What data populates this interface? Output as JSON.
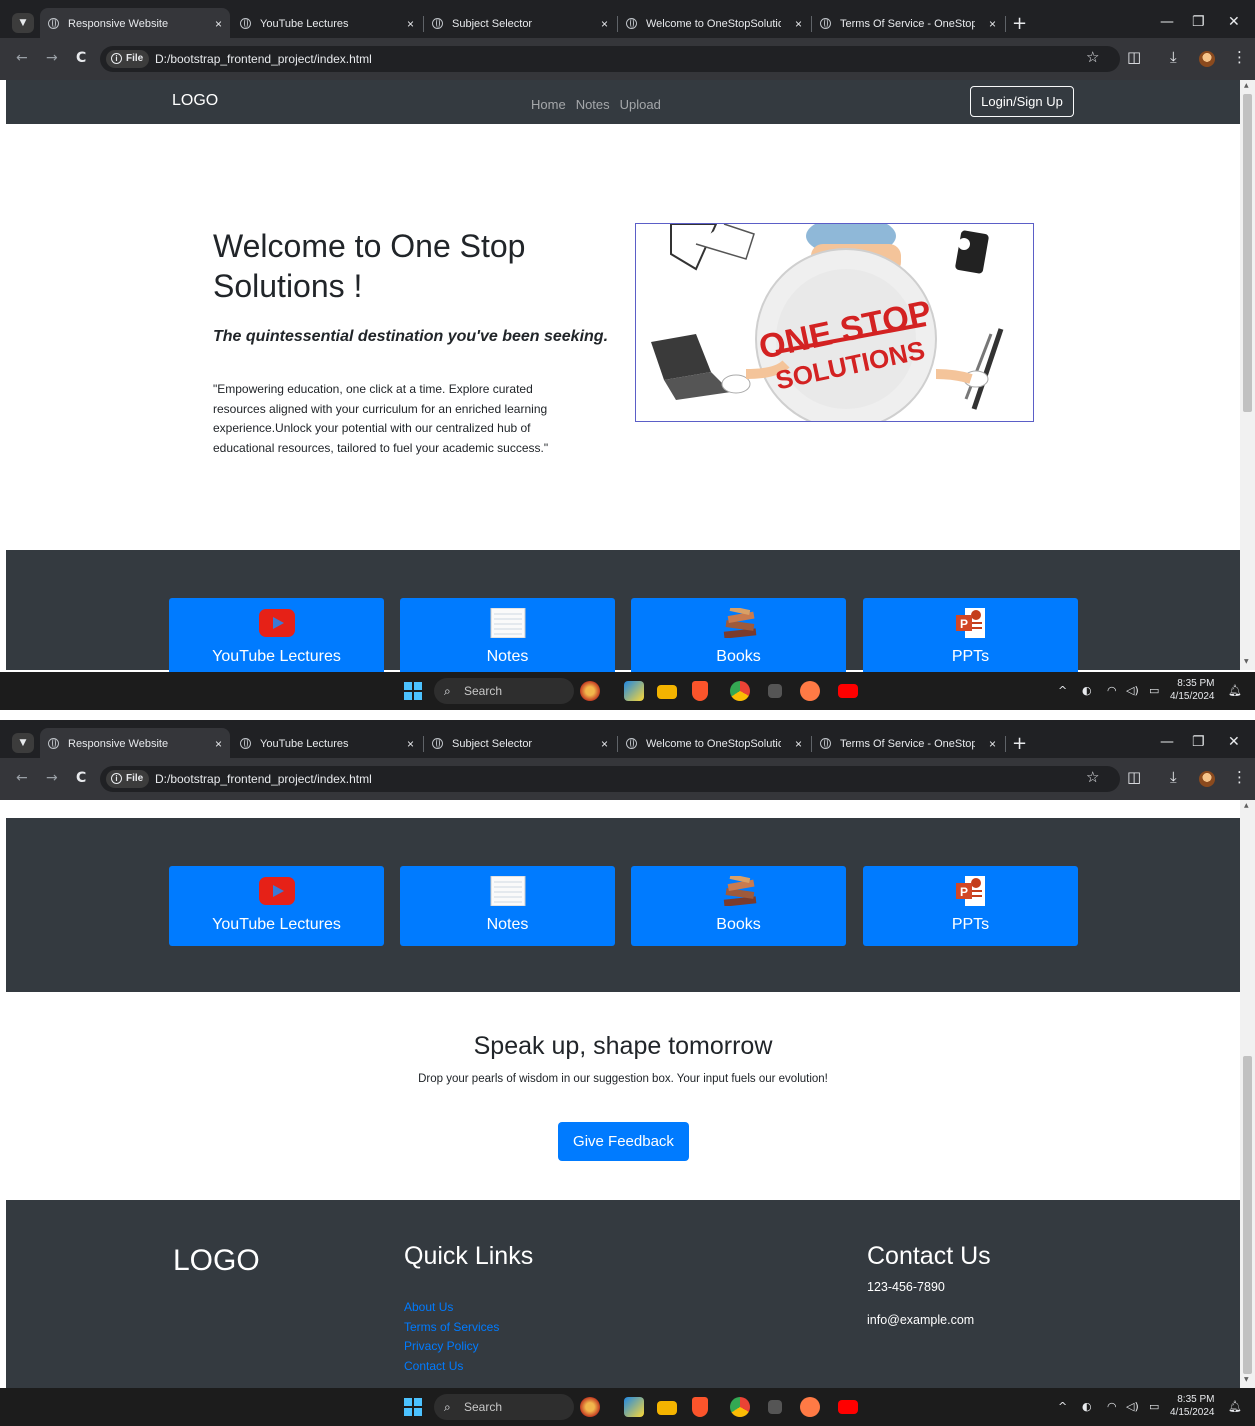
{
  "browser": {
    "tabs": [
      {
        "label": "Responsive Website",
        "active": true
      },
      {
        "label": "YouTube Lectures",
        "active": false
      },
      {
        "label": "Subject Selector",
        "active": false
      },
      {
        "label": "Welcome to OneStopSolutions",
        "active": false
      },
      {
        "label": "Terms Of Service - OneStopSolu",
        "active": false
      }
    ],
    "new_tab": "+",
    "close_glyph": "×",
    "address": {
      "chip": "File",
      "url": "D:/bootstrap_frontend_project/index.html"
    }
  },
  "site": {
    "navbar": {
      "logo": "LOGO",
      "links": [
        "Home",
        "Notes",
        "Upload"
      ],
      "login": "Login/Sign Up"
    },
    "hero": {
      "title": "Welcome to One Stop Solutions !",
      "subtitle": "The quintessential destination you've been seeking.",
      "description": "\"Empowering education, one click at a time. Explore curated resources aligned with your curriculum for an enriched learning experience.Unlock your potential with our centralized hub of educational resources, tailored to fuel your academic success.\"",
      "image_text_1": "ONE STOP",
      "image_text_2": "SOLUTIONS"
    },
    "services": [
      {
        "label": "YouTube Lectures",
        "icon": "youtube-icon"
      },
      {
        "label": "Notes",
        "icon": "notepad-icon"
      },
      {
        "label": "Books",
        "icon": "books-icon"
      },
      {
        "label": "PPTs",
        "icon": "powerpoint-icon"
      }
    ],
    "feedback": {
      "title": "Speak up, shape tomorrow",
      "text": "Drop your pearls of wisdom in our suggestion box. Your input fuels our evolution!",
      "button": "Give Feedback"
    },
    "footer": {
      "logo": "LOGO",
      "quick_links_title": "Quick Links",
      "quick_links": [
        "About Us",
        "Terms of Services",
        "Privacy Policy",
        "Contact Us"
      ],
      "contact_title": "Contact Us",
      "phone": "123-456-7890",
      "email": "info@example.com"
    }
  },
  "taskbar": {
    "search": "Search",
    "time": "8:35 PM",
    "date": "4/15/2024"
  },
  "colors": {
    "navbar": "#343a40",
    "primary": "#007bff",
    "browser_dark": "#202124"
  }
}
